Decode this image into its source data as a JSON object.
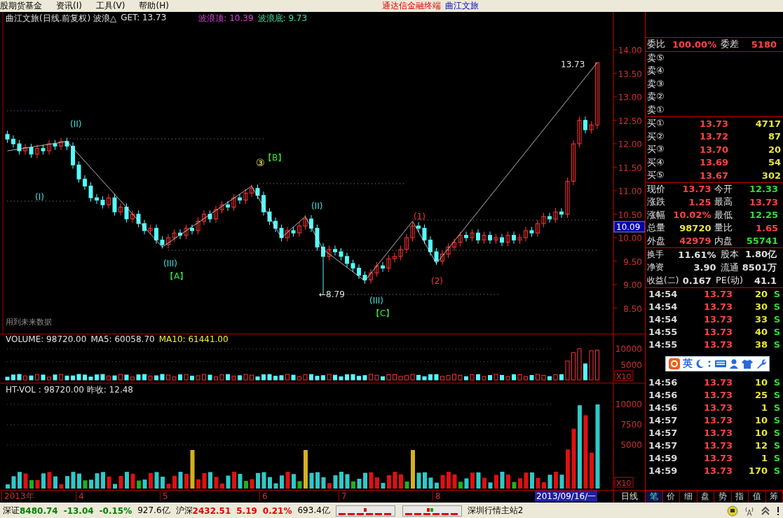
{
  "menu_bar": {
    "items": [
      "股期货基金",
      "资讯(I)",
      "工具(V)",
      "帮助(H)"
    ],
    "app_title": "通达信金融终端",
    "stock_title": "曲江文旅"
  },
  "chart_header": {
    "title": "曲江文旅(日线.前复权) 波浪△",
    "get": "GET: 13.73",
    "wave_top": "波浪顶: 10.39",
    "wave_bottom": "波浪底: 9.73"
  },
  "annotations": [
    {
      "text": "(II)",
      "kind": "wave"
    },
    {
      "text": "(I)",
      "kind": "wave"
    },
    {
      "text": "(III)",
      "kind": "wave"
    },
    {
      "text": "【A】",
      "kind": "corner"
    },
    {
      "text": "③",
      "kind": "circle"
    },
    {
      "text": "【B】",
      "kind": "corner"
    },
    {
      "text": "(II)",
      "kind": "wave"
    },
    {
      "text": "(III)",
      "kind": "wave"
    },
    {
      "text": "【C】",
      "kind": "corner"
    },
    {
      "text": "(1)",
      "kind": "minor"
    },
    {
      "text": "(2)",
      "kind": "minor"
    },
    {
      "text": "13.73",
      "kind": "price"
    },
    {
      "text": "←8.79",
      "kind": "price"
    }
  ],
  "chart_data": {
    "type": "candlestick",
    "ylim": [
      7.94,
      14.81
    ],
    "ohlc": [
      [
        12.2,
        12.28,
        12.02,
        12.1
      ],
      [
        12.1,
        12.18,
        11.92,
        12.0
      ],
      [
        12.0,
        12.08,
        11.77,
        11.85
      ],
      [
        11.85,
        12.0,
        11.77,
        11.92
      ],
      [
        11.92,
        12.0,
        11.7,
        11.78
      ],
      [
        11.78,
        11.98,
        11.7,
        11.9
      ],
      [
        11.9,
        11.98,
        11.77,
        11.85
      ],
      [
        11.85,
        12.08,
        11.77,
        12.0
      ],
      [
        12.0,
        12.08,
        11.87,
        11.95
      ],
      [
        11.95,
        12.13,
        11.87,
        12.05
      ],
      [
        12.05,
        12.13,
        11.87,
        11.95
      ],
      [
        11.95,
        12.03,
        11.47,
        11.55
      ],
      [
        11.55,
        11.63,
        11.17,
        11.25
      ],
      [
        11.25,
        11.33,
        11.02,
        11.1
      ],
      [
        11.1,
        11.18,
        10.77,
        10.85
      ],
      [
        10.85,
        10.93,
        10.72,
        10.8
      ],
      [
        10.8,
        10.88,
        10.62,
        10.7
      ],
      [
        10.7,
        10.93,
        10.62,
        10.85
      ],
      [
        10.85,
        10.93,
        10.47,
        10.55
      ],
      [
        10.55,
        10.73,
        10.47,
        10.65
      ],
      [
        10.65,
        10.73,
        10.32,
        10.4
      ],
      [
        10.4,
        10.58,
        10.32,
        10.5
      ],
      [
        10.5,
        10.58,
        10.22,
        10.3
      ],
      [
        10.3,
        10.38,
        10.07,
        10.15
      ],
      [
        10.15,
        10.28,
        10.07,
        10.2
      ],
      [
        10.2,
        10.28,
        9.87,
        9.95
      ],
      [
        9.95,
        10.03,
        9.77,
        9.85
      ],
      [
        9.85,
        10.08,
        9.77,
        10.0
      ],
      [
        10.0,
        10.18,
        9.92,
        10.1
      ],
      [
        10.1,
        10.18,
        9.97,
        10.05
      ],
      [
        10.05,
        10.28,
        9.97,
        10.2
      ],
      [
        10.2,
        10.28,
        10.07,
        10.15
      ],
      [
        10.15,
        10.43,
        10.07,
        10.35
      ],
      [
        10.35,
        10.58,
        10.27,
        10.5
      ],
      [
        10.5,
        10.58,
        10.32,
        10.4
      ],
      [
        10.4,
        10.68,
        10.32,
        10.6
      ],
      [
        10.6,
        10.78,
        10.52,
        10.7
      ],
      [
        10.7,
        10.78,
        10.57,
        10.65
      ],
      [
        10.65,
        10.93,
        10.57,
        10.85
      ],
      [
        10.85,
        10.93,
        10.72,
        10.8
      ],
      [
        10.8,
        11.03,
        10.72,
        10.95
      ],
      [
        10.95,
        11.13,
        10.87,
        11.05
      ],
      [
        11.05,
        11.13,
        10.82,
        10.9
      ],
      [
        10.9,
        10.98,
        10.47,
        10.55
      ],
      [
        10.55,
        10.63,
        10.27,
        10.35
      ],
      [
        10.35,
        10.43,
        10.12,
        10.2
      ],
      [
        10.2,
        10.28,
        9.92,
        10.0
      ],
      [
        10.0,
        10.23,
        9.92,
        10.15
      ],
      [
        10.15,
        10.23,
        10.02,
        10.1
      ],
      [
        10.1,
        10.33,
        10.02,
        10.25
      ],
      [
        10.25,
        10.48,
        10.17,
        10.4
      ],
      [
        10.4,
        10.48,
        10.12,
        10.2
      ],
      [
        10.2,
        10.28,
        9.72,
        9.8
      ],
      [
        9.8,
        9.88,
        8.79,
        9.6
      ],
      [
        9.6,
        9.83,
        9.52,
        9.75
      ],
      [
        9.75,
        9.83,
        9.62,
        9.7
      ],
      [
        9.7,
        9.78,
        9.52,
        9.6
      ],
      [
        9.6,
        9.68,
        9.37,
        9.45
      ],
      [
        9.45,
        9.53,
        9.27,
        9.35
      ],
      [
        9.35,
        9.43,
        9.12,
        9.2
      ],
      [
        9.2,
        9.28,
        9.02,
        9.1
      ],
      [
        9.1,
        9.33,
        9.02,
        9.25
      ],
      [
        9.25,
        9.48,
        9.17,
        9.4
      ],
      [
        9.4,
        9.48,
        9.27,
        9.35
      ],
      [
        9.35,
        9.63,
        9.27,
        9.55
      ],
      [
        9.55,
        9.68,
        9.47,
        9.6
      ],
      [
        9.6,
        9.83,
        9.52,
        9.75
      ],
      [
        9.75,
        10.08,
        9.67,
        10.0
      ],
      [
        10.0,
        10.33,
        9.92,
        10.25
      ],
      [
        10.25,
        10.33,
        10.12,
        10.2
      ],
      [
        10.2,
        10.28,
        9.87,
        9.95
      ],
      [
        9.95,
        10.03,
        9.62,
        9.7
      ],
      [
        9.7,
        9.78,
        9.42,
        9.5
      ],
      [
        9.5,
        9.73,
        9.42,
        9.65
      ],
      [
        9.65,
        9.88,
        9.57,
        9.8
      ],
      [
        9.8,
        9.98,
        9.72,
        9.9
      ],
      [
        9.9,
        10.13,
        9.82,
        10.05
      ],
      [
        10.05,
        10.13,
        9.92,
        10.0
      ],
      [
        10.0,
        10.18,
        9.92,
        10.1
      ],
      [
        10.1,
        10.18,
        9.87,
        9.95
      ],
      [
        9.95,
        10.13,
        9.87,
        10.05
      ],
      [
        10.05,
        10.13,
        9.87,
        9.95
      ],
      [
        9.95,
        10.08,
        9.87,
        10.0
      ],
      [
        10.0,
        10.08,
        9.82,
        9.9
      ],
      [
        9.9,
        10.13,
        9.82,
        10.05
      ],
      [
        10.05,
        10.13,
        9.87,
        9.95
      ],
      [
        9.95,
        10.08,
        9.87,
        10.0
      ],
      [
        10.0,
        10.23,
        9.92,
        10.15
      ],
      [
        10.15,
        10.23,
        10.02,
        10.1
      ],
      [
        10.1,
        10.38,
        10.02,
        10.3
      ],
      [
        10.3,
        10.53,
        10.22,
        10.45
      ],
      [
        10.45,
        10.53,
        10.32,
        10.4
      ],
      [
        10.4,
        10.63,
        10.32,
        10.55
      ],
      [
        10.55,
        10.63,
        10.42,
        10.5
      ],
      [
        10.5,
        11.28,
        10.42,
        11.2
      ],
      [
        11.2,
        12.08,
        11.12,
        12.0
      ],
      [
        12.0,
        12.58,
        11.92,
        12.5
      ],
      [
        12.5,
        12.58,
        12.22,
        12.3
      ],
      [
        12.3,
        12.48,
        12.22,
        12.4
      ],
      [
        12.4,
        13.73,
        12.32,
        13.73
      ]
    ]
  },
  "future_note": "用到未来数据",
  "price_axis": {
    "ticks": [
      "14.00",
      "13.50",
      "13.00",
      "12.50",
      "12.00",
      "11.50",
      "11.00",
      "10.50",
      "10.00",
      "9.50",
      "9.00",
      "8.50"
    ],
    "current": "10.09"
  },
  "volume_panel": {
    "label": "VOLUME: 98720.00",
    "ma5": "MA5: 60058.70",
    "ma10": "MA10: 61441.00",
    "ticks": [
      "10000",
      "5000"
    ],
    "scale": "X10"
  },
  "htvol_panel": {
    "label": "HT-VOL : 98720.00 昨收: 12.48",
    "ticks": [
      "10000",
      "7500",
      "5000"
    ],
    "scale": "X10"
  },
  "date_axis": {
    "labels": [
      "2013年",
      "4",
      "5",
      "6",
      "7",
      "8"
    ],
    "cursor": "2013/09/16/一",
    "period": "日线"
  },
  "quote": {
    "header": {
      "label": "委比",
      "value": "100.00%",
      "label2": "委差",
      "value2": "5180"
    },
    "asks": [
      "卖⑤",
      "卖④",
      "卖③",
      "卖②",
      "卖①"
    ],
    "bids": [
      {
        "label": "买①",
        "price": "13.73",
        "volume": "4717"
      },
      {
        "label": "买②",
        "price": "13.72",
        "volume": "87"
      },
      {
        "label": "买③",
        "price": "13.70",
        "volume": "20"
      },
      {
        "label": "买④",
        "price": "13.69",
        "volume": "54"
      },
      {
        "label": "买⑤",
        "price": "13.67",
        "volume": "302"
      }
    ],
    "stats": [
      {
        "label": "现价",
        "value": "13.73",
        "color": "#ff4444"
      },
      {
        "label": "今开",
        "value": "12.33",
        "color": "#33dd33"
      },
      {
        "label": "涨跌",
        "value": "1.25",
        "color": "#ff4444"
      },
      {
        "label": "最高",
        "value": "13.73",
        "color": "#ff4444"
      },
      {
        "label": "涨幅",
        "value": "10.02%",
        "color": "#ff4444"
      },
      {
        "label": "最低",
        "value": "12.25",
        "color": "#33dd33"
      },
      {
        "label": "总量",
        "value": "98720",
        "color": "#e6e640"
      },
      {
        "label": "量比",
        "value": "1.65",
        "color": "#ff4444"
      },
      {
        "label": "外盘",
        "value": "42979",
        "color": "#ff4444"
      },
      {
        "label": "内盘",
        "value": "55741",
        "color": "#33dd33"
      }
    ],
    "fundamentals": [
      {
        "label": "换手",
        "value": "11.61%",
        "label2": "股本",
        "value2": "1.80亿"
      },
      {
        "label": "净资",
        "value": "3.90",
        "label2": "流通",
        "value2": "8501万"
      },
      {
        "label": "收益(二)",
        "value": "0.167",
        "label2": "PE(动)",
        "value2": "41.1"
      }
    ]
  },
  "trades_top": [
    {
      "time": "14:54",
      "price": "13.73",
      "volume": "20",
      "side": "S"
    },
    {
      "time": "14:54",
      "price": "13.73",
      "volume": "30",
      "side": "S"
    },
    {
      "time": "14:54",
      "price": "13.73",
      "volume": "33",
      "side": "S"
    },
    {
      "time": "14:55",
      "price": "13.73",
      "volume": "40",
      "side": "S"
    },
    {
      "time": "14:55",
      "price": "13.73",
      "volume": "38",
      "side": "S"
    }
  ],
  "ime_bar": {
    "label": "英"
  },
  "trades_bottom": [
    {
      "time": "14:56",
      "price": "13.73",
      "volume": "10",
      "side": "S"
    },
    {
      "time": "14:56",
      "price": "13.73",
      "volume": "25",
      "side": "S"
    },
    {
      "time": "14:56",
      "price": "13.73",
      "volume": "1",
      "side": "S"
    },
    {
      "time": "14:57",
      "price": "13.73",
      "volume": "10",
      "side": "S"
    },
    {
      "time": "14:57",
      "price": "13.73",
      "volume": "10",
      "side": "S"
    },
    {
      "time": "14:57",
      "price": "13.73",
      "volume": "12",
      "side": "S"
    },
    {
      "time": "14:59",
      "price": "13.73",
      "volume": "1",
      "side": "S"
    },
    {
      "time": "14:59",
      "price": "13.73",
      "volume": "170",
      "side": "S"
    }
  ],
  "panel_tabs": [
    {
      "label": "笔",
      "selected": true
    },
    {
      "label": "价",
      "selected": false
    },
    {
      "label": "细",
      "selected": false
    },
    {
      "label": "盘",
      "selected": false
    },
    {
      "label": "势",
      "selected": false
    },
    {
      "label": "指",
      "selected": false
    },
    {
      "label": "值",
      "selected": false
    },
    {
      "label": "筹",
      "selected": false
    }
  ],
  "status_bar": {
    "indices": [
      {
        "name": "深证",
        "value": "8480.74",
        "change": "-13.04",
        "pct": "-0.15%",
        "amount": "927.6亿",
        "color": "#008000"
      },
      {
        "name": "沪深",
        "value": "2432.51",
        "change": "5.19",
        "pct": "0.21%",
        "amount": "693.4亿",
        "color": "#e00000"
      }
    ],
    "server": "深圳行情主站2"
  }
}
